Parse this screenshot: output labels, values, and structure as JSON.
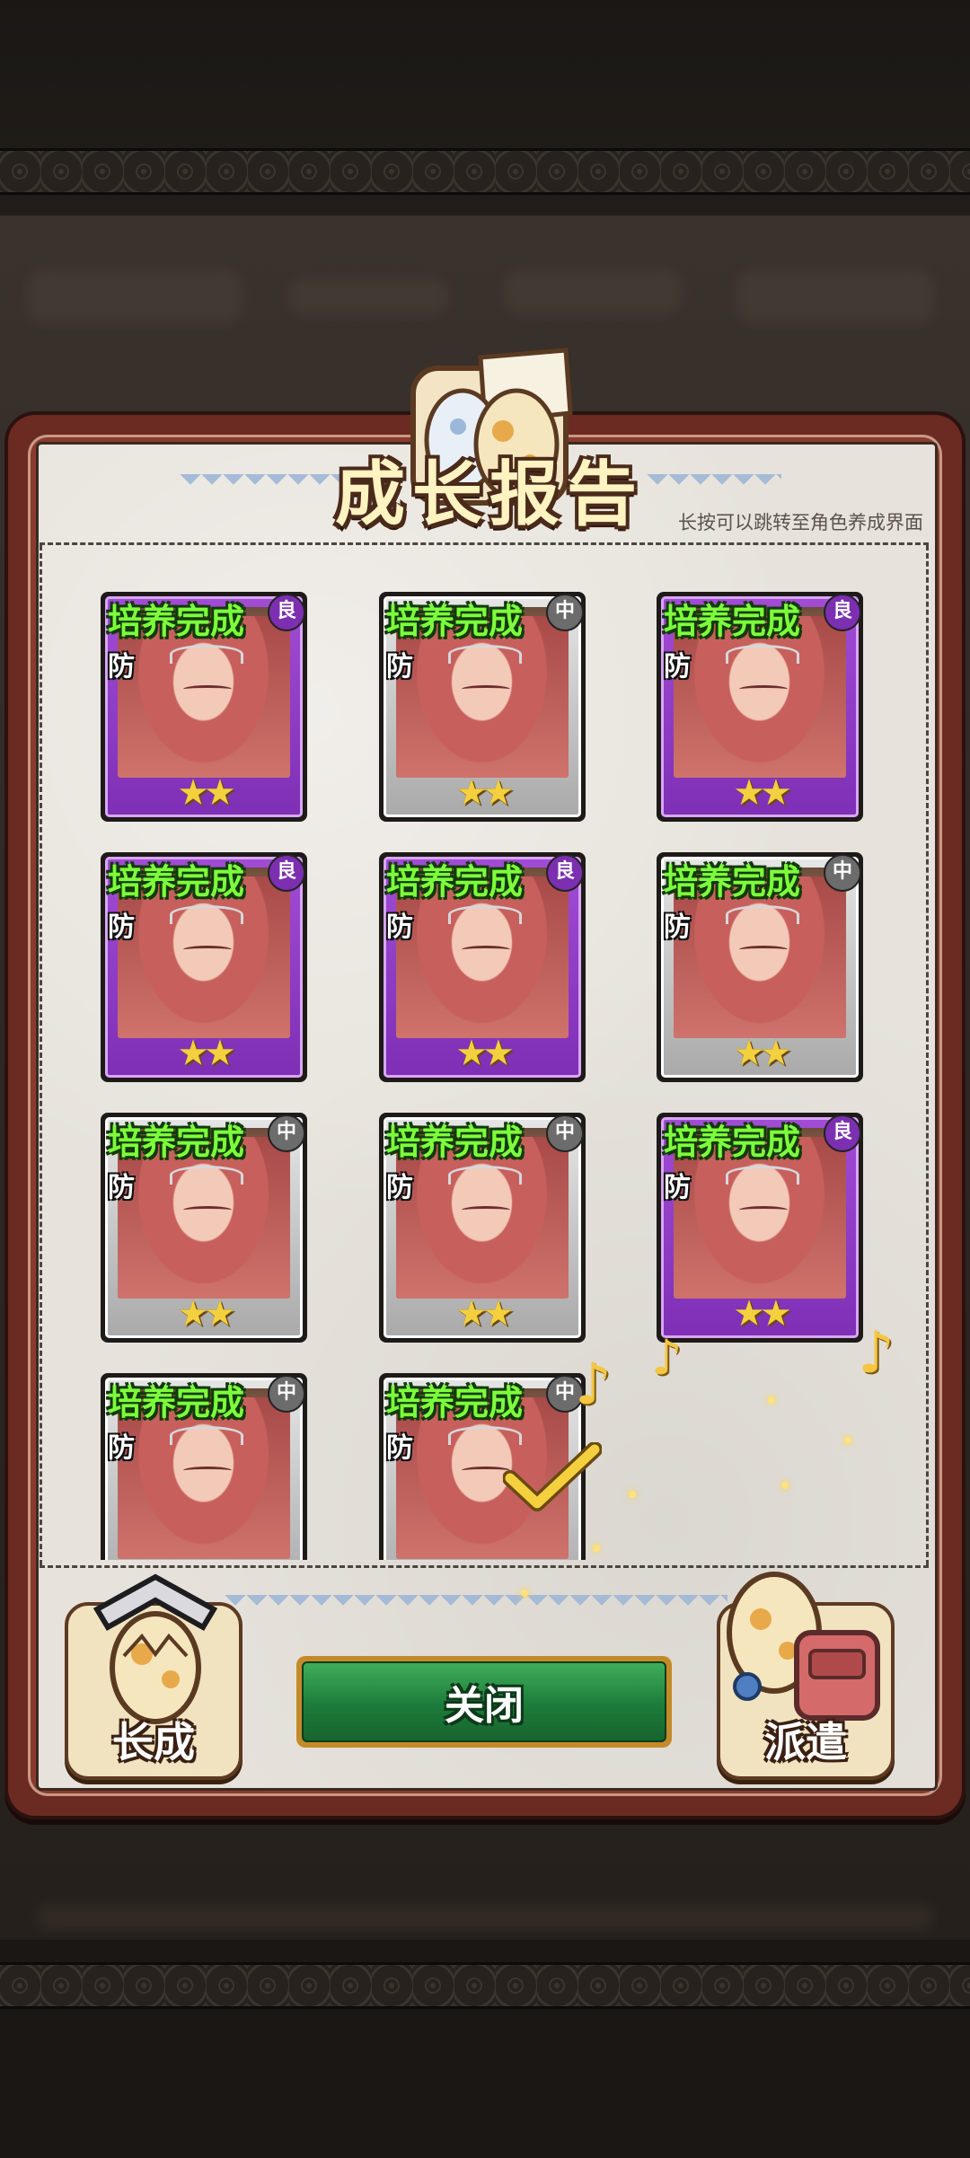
{
  "panel": {
    "title": "成长报告",
    "hint": "长按可以跳转至角色养成界面"
  },
  "cards": [
    {
      "status": "培养完成",
      "role": "防",
      "rank": "良",
      "rarity": "good",
      "stars": "★★"
    },
    {
      "status": "培养完成",
      "role": "防",
      "rank": "中",
      "rarity": "mid",
      "stars": "★★"
    },
    {
      "status": "培养完成",
      "role": "防",
      "rank": "良",
      "rarity": "good",
      "stars": "★★"
    },
    {
      "status": "培养完成",
      "role": "防",
      "rank": "良",
      "rarity": "good",
      "stars": "★★"
    },
    {
      "status": "培养完成",
      "role": "防",
      "rank": "良",
      "rarity": "good",
      "stars": "★★"
    },
    {
      "status": "培养完成",
      "role": "防",
      "rank": "中",
      "rarity": "mid",
      "stars": "★★"
    },
    {
      "status": "培养完成",
      "role": "防",
      "rank": "中",
      "rarity": "mid",
      "stars": "★★"
    },
    {
      "status": "培养完成",
      "role": "防",
      "rank": "中",
      "rarity": "mid",
      "stars": "★★"
    },
    {
      "status": "培养完成",
      "role": "防",
      "rank": "良",
      "rarity": "good",
      "stars": "★★"
    },
    {
      "status": "培养完成",
      "role": "防",
      "rank": "中",
      "rarity": "mid",
      "stars": "★★"
    },
    {
      "status": "培养完成",
      "role": "防",
      "rank": "中",
      "rarity": "mid",
      "stars": "★★"
    }
  ],
  "buttons": {
    "grow": "长成",
    "close": "关闭",
    "dispatch": "派遣"
  },
  "colors": {
    "good": "#8e3cc6",
    "mid": "#bdbdbd",
    "status_text": "#7dff3c",
    "close_button": "#1d7b3a"
  },
  "decorations": {
    "note_glyph": "♪"
  }
}
